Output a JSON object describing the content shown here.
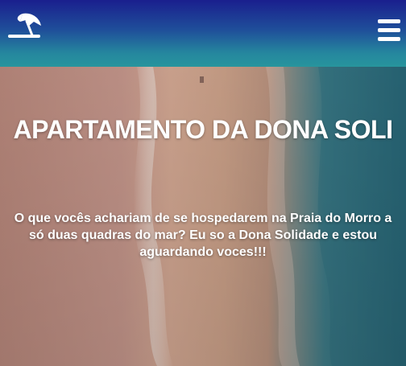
{
  "navbar": {
    "logo_icon": "beach-umbrella-icon",
    "menu_icon": "hamburger-menu-icon",
    "background_colors": [
      "#1a1f8e",
      "#27959d"
    ]
  },
  "hero": {
    "title": "APARTAMENTO DA DONA SOLI",
    "text": "O que vocês achariam de se hospedarem na Praia do Morro a só duas quadras do mar? Eu so a Dona Solidade e estou aguardando voces!!!",
    "background_colors": {
      "sand": "#c79a87",
      "wet_sand": "#b4857a",
      "sea": "#2f6f7e"
    }
  }
}
